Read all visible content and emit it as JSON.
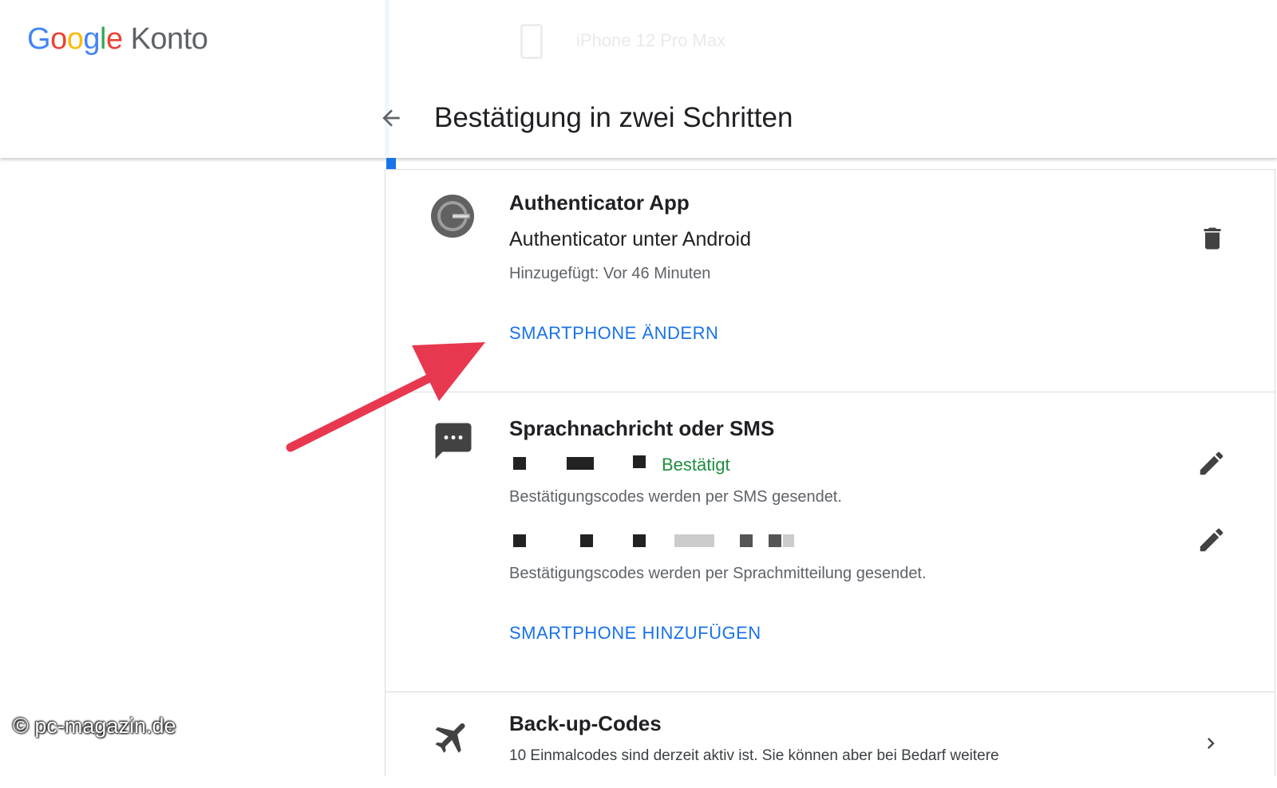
{
  "header": {
    "logo_letters": [
      "G",
      "o",
      "o",
      "g",
      "l",
      "e"
    ],
    "logo_suffix": "Konto",
    "ghost_device": "iPhone 12 Pro Max",
    "title": "Bestätigung in zwei Schritten",
    "back_icon": "arrow-back-icon"
  },
  "authenticator": {
    "title": "Authenticator App",
    "device": "Authenticator unter Android",
    "added": "Hinzugefügt: Vor 46 Minuten",
    "action": "SMARTPHONE ÄNDERN",
    "icon": "authenticator-app-icon",
    "delete_icon": "trash-icon"
  },
  "sms": {
    "title": "Sprachnachricht oder SMS",
    "status": "Bestätigt",
    "desc1": "Bestätigungscodes werden per SMS gesendet.",
    "desc2": "Bestätigungscodes werden per Sprachmitteilung gesendet.",
    "action": "SMARTPHONE HINZUFÜGEN",
    "icon": "message-icon",
    "edit_icon": "pencil-icon"
  },
  "backup": {
    "title": "Back-up-Codes",
    "desc": "10 Einmalcodes sind derzeit aktiv ist. Sie können aber bei Bedarf weitere",
    "icon": "airplane-icon",
    "chevron_icon": "chevron-right-icon"
  },
  "annotation": {
    "color": "#e8384f"
  },
  "watermark": "© pc-magazin.de",
  "colors": {
    "accent": "#1a73e8",
    "success": "#1e8e3e"
  }
}
